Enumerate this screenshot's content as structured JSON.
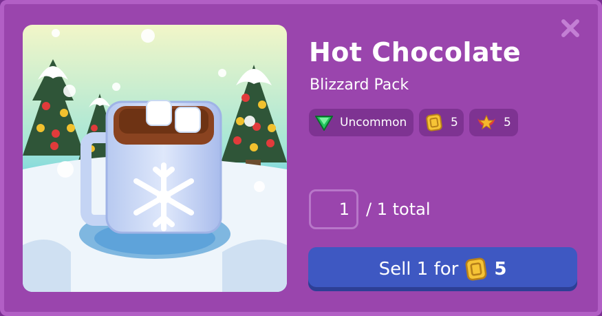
{
  "item": {
    "name": "Hot Chocolate",
    "pack": "Blizzard Pack"
  },
  "badges": {
    "rarity": {
      "label": "Uncommon",
      "icon": "green-gem-icon",
      "color": "#22c55e"
    },
    "value": {
      "label": "5",
      "icon": "gold-token-icon"
    },
    "xp": {
      "label": "5",
      "icon": "winged-star-icon"
    }
  },
  "quantity": {
    "value": "1",
    "total_text": "/ 1 total"
  },
  "sell": {
    "label": "Sell 1 for",
    "amount": "5",
    "icon": "gold-token-icon"
  },
  "close": {
    "icon": "close-icon"
  },
  "colors": {
    "modal_bg": "#9a45ad",
    "chip_bg": "#7e3392",
    "button_bg": "#3e58c2"
  }
}
